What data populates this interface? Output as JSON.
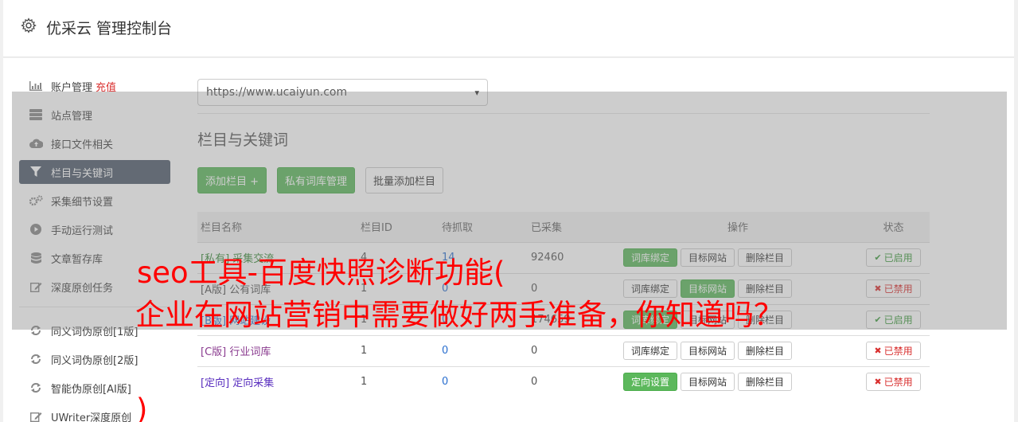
{
  "header": {
    "title": "优采云 管理控制台",
    "icon": "gear-icon"
  },
  "sidebar": {
    "items": [
      {
        "label": "账户管理",
        "badge": "充值",
        "icon": "bar-chart-icon"
      },
      {
        "label": "站点管理",
        "icon": "server-icon"
      },
      {
        "label": "接口文件相关",
        "icon": "cloud-upload-icon"
      },
      {
        "label": "栏目与关键词",
        "icon": "filter-icon",
        "active": true
      },
      {
        "label": "采集细节设置",
        "icon": "gears-icon"
      },
      {
        "label": "手动运行测试",
        "icon": "play-circle-icon"
      },
      {
        "label": "文章暂存库",
        "icon": "database-icon"
      },
      {
        "label": "深度原创任务",
        "icon": "edit-icon"
      },
      {
        "label": "同义词伪原创[1版]",
        "icon": "refresh-icon"
      },
      {
        "label": "同义词伪原创[2版]",
        "icon": "refresh-icon"
      },
      {
        "label": "智能伪原创[AI版]",
        "icon": "refresh-icon"
      },
      {
        "label": "UWriter深度原创",
        "icon": "edit-icon"
      }
    ]
  },
  "site_select": {
    "value": "https://www.ucaiyun.com"
  },
  "section": {
    "title": "栏目与关键词"
  },
  "toolbar": {
    "add_column": "添加栏目 +",
    "private_lib": "私有词库管理",
    "batch_add": "批量添加栏目"
  },
  "table": {
    "headers": {
      "name": "栏目名称",
      "id": "栏目ID",
      "pending": "待抓取",
      "collected": "已采集",
      "ops": "操作",
      "status": "状态"
    },
    "rows": [
      {
        "tag": "[私有]",
        "name": "采集交流",
        "id": "4",
        "pending": "14",
        "collected": "92460",
        "op1": "词库绑定",
        "op2": "目标网站",
        "op3": "删除栏目",
        "status": "已启用"
      },
      {
        "tag": "[A版]",
        "name": "公有词库",
        "id": "1",
        "pending": "0",
        "collected": "0",
        "op1": "词库绑定",
        "op2": "目标网站",
        "op3": "删除栏目",
        "status": "已禁用"
      },
      {
        "tag": "[B版]",
        "name": "网站建设",
        "id": "1",
        "pending": "0",
        "collected": "174659",
        "op1": "词库绑定",
        "op2": "目标网站",
        "op3": "删除栏目",
        "status": "已启用"
      },
      {
        "tag": "[C版]",
        "name": "行业词库",
        "id": "1",
        "pending": "0",
        "collected": "0",
        "op1": "词库绑定",
        "op2": "目标网站",
        "op3": "删除栏目",
        "status": "已禁用"
      },
      {
        "tag": "[定向]",
        "name": "定向采集",
        "id": "1",
        "pending": "0",
        "collected": "0",
        "op1": "定向设置",
        "op2": "目标网站",
        "op3": "删除栏目",
        "status": "已禁用"
      }
    ]
  },
  "overlay_text": {
    "line1": "seo工具-百度快照诊断功能(",
    "line2": "企业在网站营销中需要做好两手准备，你知道吗？",
    "line3": ")"
  },
  "colors": {
    "accent_green": "#5cb85c",
    "danger_red": "#d9302f",
    "active_nav": "#4f5b6b",
    "overlay_text": "#ff0000"
  }
}
